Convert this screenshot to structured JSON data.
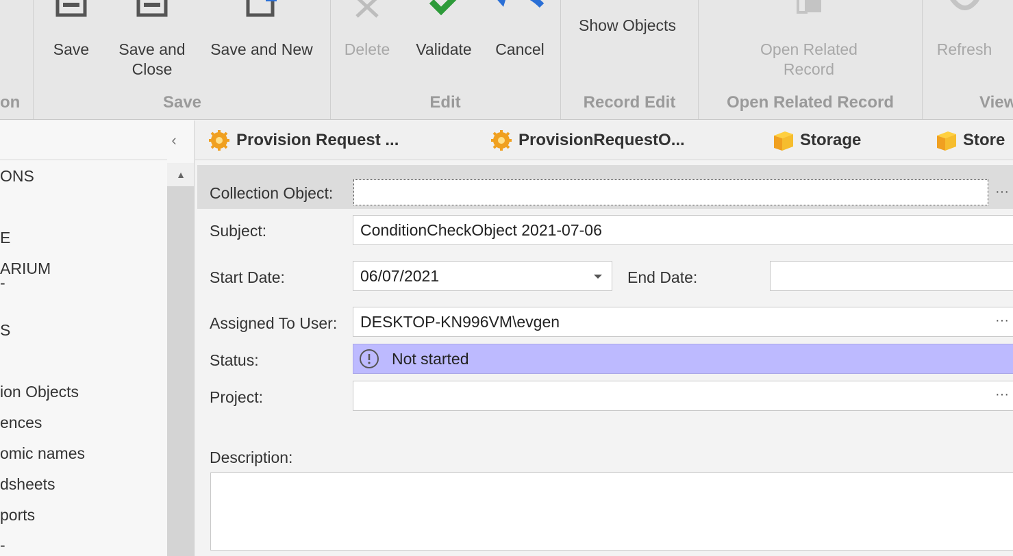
{
  "ribbon": {
    "groups": {
      "left_partial": "on",
      "save": "Save",
      "edit": "Edit",
      "record_edit": "Record Edit",
      "open_related": "Open Related Record",
      "view_partial": "View"
    },
    "buttons": {
      "save": "Save",
      "save_close_1": "Save and",
      "save_close_2": "Close",
      "save_new": "Save and New",
      "delete": "Delete",
      "validate": "Validate",
      "cancel": "Cancel",
      "show_objects": "Show Objects",
      "open_related_1": "Open Related",
      "open_related_2": "Record",
      "refresh": "Refresh"
    },
    "colors": {
      "validate_check": "#2e9b3a",
      "cancel_arrow": "#2a6fd6",
      "disabled": "#b5b5b5"
    }
  },
  "nav": {
    "collapse_glyph": "‹",
    "scroll_up_glyph": "▲",
    "items": [
      "ONS",
      "E",
      "ARIUM",
      "-",
      "S",
      "ion Objects",
      "ences",
      "omic names",
      "dsheets",
      "ports",
      "-"
    ]
  },
  "tabs": [
    {
      "label": "Provision Request ...",
      "icon": "gear-icon"
    },
    {
      "label": "ProvisionRequestO...",
      "icon": "gear-icon"
    },
    {
      "label": "Storage",
      "icon": "box-icon"
    },
    {
      "label": "Store",
      "icon": "box-icon"
    }
  ],
  "form": {
    "collection_object": {
      "label": "Collection Object:",
      "value": ""
    },
    "subject": {
      "label": "Subject:",
      "value": "ConditionCheckObject 2021-07-06"
    },
    "start_date": {
      "label": "Start Date:",
      "value": "06/07/2021"
    },
    "end_date": {
      "label": "End Date:",
      "value": ""
    },
    "assigned_to": {
      "label": "Assigned To User:",
      "value": "DESKTOP-KN996VM\\evgen"
    },
    "status": {
      "label": "Status:",
      "value": "Not started",
      "color": "#bdbaff"
    },
    "project": {
      "label": "Project:",
      "value": ""
    },
    "description": {
      "label": "Description:",
      "value": ""
    },
    "ellipsis": "···"
  }
}
